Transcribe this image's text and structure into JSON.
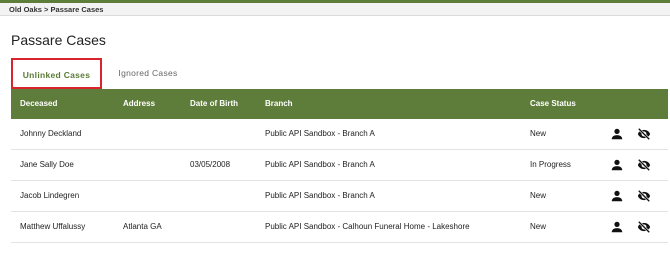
{
  "breadcrumb": {
    "parent": "Old Oaks",
    "separator": ">",
    "current": "Passare Cases"
  },
  "page": {
    "title": "Passare Cases"
  },
  "tabs": [
    {
      "label": "Unlinked Cases"
    },
    {
      "label": "Ignored Cases"
    }
  ],
  "table": {
    "headers": {
      "deceased": "Deceased",
      "address": "Address",
      "dob": "Date of Birth",
      "branch": "Branch",
      "status": "Case Status"
    },
    "rows": [
      {
        "deceased": "Johnny Deckland",
        "address": "",
        "dob": "",
        "branch": "Public API Sandbox - Branch A",
        "status": "New"
      },
      {
        "deceased": "Jane Sally Doe",
        "address": "",
        "dob": "03/05/2008",
        "branch": "Public API Sandbox - Branch A",
        "status": "In Progress"
      },
      {
        "deceased": "Jacob Lindegren",
        "address": "",
        "dob": "",
        "branch": "Public API Sandbox - Branch A",
        "status": "New"
      },
      {
        "deceased": "Matthew Uffalussy",
        "address": "Atlanta GA",
        "dob": "",
        "branch": "Public API Sandbox - Calhoun Funeral Home - Lakeshore",
        "status": "New"
      }
    ],
    "row_actions": [
      "person-icon",
      "eye-slash-icon"
    ]
  },
  "colors": {
    "accent": "#5e7d3a",
    "highlight_border": "#d9232d",
    "active_tab_text": "#5a7a35"
  }
}
